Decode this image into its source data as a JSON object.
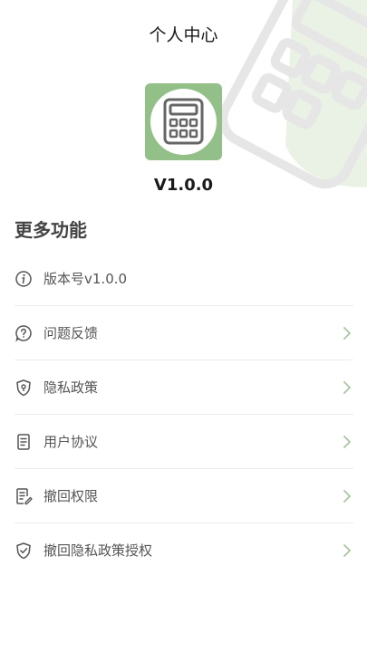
{
  "header": {
    "title": "个人中心"
  },
  "app": {
    "version": "V1.0.0"
  },
  "section": {
    "title": "更多功能"
  },
  "menu": {
    "items": [
      {
        "label": "版本号v1.0.0",
        "icon": "info-icon"
      },
      {
        "label": "问题反馈",
        "icon": "question-bubble-icon"
      },
      {
        "label": "隐私政策",
        "icon": "shield-lock-icon"
      },
      {
        "label": "用户协议",
        "icon": "document-icon"
      },
      {
        "label": "撤回权限",
        "icon": "document-edit-icon"
      },
      {
        "label": "撤回隐私政策授权",
        "icon": "shield-check-icon"
      }
    ]
  },
  "colors": {
    "accent": "#93c088",
    "text": "#555555",
    "chevron": "#a9c79f"
  }
}
